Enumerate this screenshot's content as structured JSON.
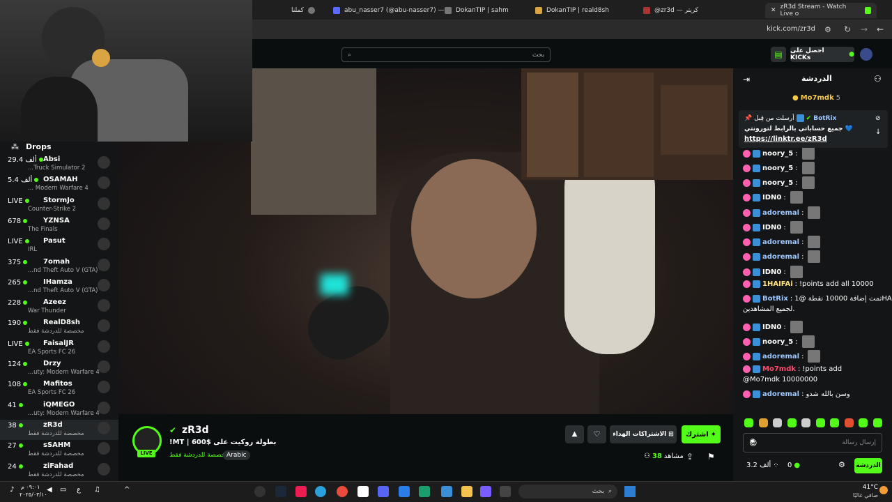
{
  "browser": {
    "tabs": [
      {
        "label": "كملنا"
      },
      {
        "label": "abu_nasser7 (@abu-nasser7) —"
      },
      {
        "label": "DokanTIP | sahm"
      },
      {
        "label": "DokanTIP | reald8sh"
      },
      {
        "label": "@zr3d — كريتر"
      },
      {
        "label": "zR3d Stream - Watch Live o"
      }
    ],
    "url": "kick.com/zr3d"
  },
  "header": {
    "search_placeholder": "بحث",
    "get_kicks_label": "احصل على KICKs"
  },
  "sidebar": {
    "drops_label": "Drops",
    "streams": [
      {
        "count": "29.4 ألف",
        "name": "Absi",
        "game": "...Truck Simulator 2"
      },
      {
        "count": "5.4 ألف",
        "name": "OSAMAH",
        "game": "... Modern Warfare 4"
      },
      {
        "count": "LIVE",
        "name": "StormJo",
        "game": "Counter-Strike 2"
      },
      {
        "count": "678",
        "name": "YZNSA",
        "game": "The Finals"
      },
      {
        "count": "LIVE",
        "name": "Pasut",
        "game": "IRL"
      },
      {
        "count": "375",
        "name": "7omah",
        "game": "...nd Theft Auto V (GTA)"
      },
      {
        "count": "265",
        "name": "IHamza",
        "game": "...nd Theft Auto V (GTA)"
      },
      {
        "count": "228",
        "name": "Azeez",
        "game": "War Thunder"
      },
      {
        "count": "190",
        "name": "RealD8sh",
        "game": "مخصصة للدردشة فقط"
      },
      {
        "count": "LIVE",
        "name": "FaisalJR",
        "game": "EA Sports FC 26"
      },
      {
        "count": "124",
        "name": "Drzy",
        "game": "...uty: Modern Warfare 4"
      },
      {
        "count": "108",
        "name": "Mafitos",
        "game": "EA Sports FC 26"
      },
      {
        "count": "41",
        "name": "iQMEGO",
        "game": "...uty: Modern Warfare 4"
      },
      {
        "count": "38",
        "name": "zR3d",
        "game": "مخصصة للدردشة فقط"
      },
      {
        "count": "27",
        "name": "sSAHM",
        "game": "مخصصة للدردشة فقط"
      },
      {
        "count": "24",
        "name": "ziFahad",
        "game": "مخصصة للدردشة فقط"
      }
    ]
  },
  "stream": {
    "channel_name": "zR3d",
    "title": "بطولة روكيت على $600 | MT!",
    "category": "مخصصة للدردشة فقط",
    "language": "Arabic",
    "live_label": "LIVE",
    "viewers": "38",
    "viewers_label": "مشاهد",
    "subscribe_label": "اشترك",
    "gift_label": "الاشتراكات الهداء"
  },
  "chat": {
    "title": "الدردشة",
    "top_user": "Mo7mdk",
    "top_count": "5",
    "pinned": {
      "by": "BotRix",
      "sent_label": "أرسلت من قِبل",
      "text": "جميع حساباتي بالرابط لتورونتي 💙",
      "link": "https://linktr.ee/zR3d"
    },
    "messages": [
      {
        "user": "noory_5",
        "text": "",
        "color": "#ffffff"
      },
      {
        "user": "noory_5",
        "text": "",
        "color": "#ffffff"
      },
      {
        "user": "noory_5",
        "text": "",
        "color": "#ffffff"
      },
      {
        "user": "IDN0",
        "text": "",
        "color": "#ffffff"
      },
      {
        "user": "adoremal",
        "text": "",
        "color": "#9ec8ff"
      },
      {
        "user": "IDN0",
        "text": "",
        "color": "#ffffff"
      },
      {
        "user": "adoremal",
        "text": "",
        "color": "#9ec8ff"
      },
      {
        "user": "adoremal",
        "text": "",
        "color": "#9ec8ff"
      },
      {
        "user": "IDN0",
        "text": "",
        "color": "#ffffff"
      },
      {
        "user": "1HAIFAi",
        "text": "!points add all 10000",
        "color": "#ffe37a"
      },
      {
        "user": "BotRix",
        "text": "تمت إضافة 10000 نقطة @1HAIFAi",
        "color": "#9ec8ff"
      },
      {
        "user": "",
        "text": "لجميع المشاهدين.",
        "color": "#ffffff"
      },
      {
        "user": "IDN0",
        "text": "",
        "color": "#ffffff"
      },
      {
        "user": "noory_5",
        "text": "",
        "color": "#ffffff"
      },
      {
        "user": "adoremal",
        "text": "",
        "color": "#9ec8ff"
      },
      {
        "user": "Mo7mdk",
        "text": "!points add",
        "color": "#ff4b6e"
      },
      {
        "user": "",
        "text": "@Mo7mdk 10000000",
        "color": "#ffffff"
      },
      {
        "user": "adoremal",
        "text": "وسن بالله شدو",
        "color": "#9ec8ff"
      }
    ],
    "input_placeholder": "إرسال رسالة",
    "send_label": "الدردشة",
    "points": "3.2 ألف",
    "kicks": "0"
  },
  "taskbar": {
    "search_label": "بحث",
    "time": "٠٩:٠١ م",
    "date": "٢٠٢٥/٠٣/١٠",
    "weather_temp": "41°C",
    "weather_desc": "صافي غالبًا",
    "lang": "ع"
  },
  "colors": {
    "accent": "#53fc18",
    "bg": "#0b0e0f",
    "panel": "#141516"
  }
}
